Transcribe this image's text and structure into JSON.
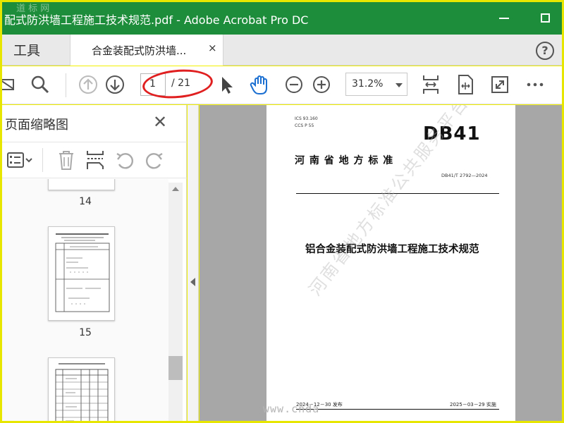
{
  "window": {
    "title": "配式防洪墙工程施工技术规范.pdf - Adobe Acrobat Pro DC",
    "corner_watermark": "道 标 网",
    "accent_color": "#1e8d3b"
  },
  "tabs": {
    "tools_label": "工具",
    "doc_tab_label": "合金装配式防洪墙...",
    "close_glyph": "×",
    "help_glyph": "?"
  },
  "toolbar": {
    "current_page": "1",
    "page_total": "/ 21",
    "zoom": "31.2%"
  },
  "sidebar": {
    "title": "页面缩略图",
    "close_glyph": "✕",
    "thumbnails": [
      {
        "label": "14"
      },
      {
        "label": "15"
      }
    ]
  },
  "document": {
    "ics": "ICS 93.160",
    "ccs": "CCS P 55",
    "logo": "DB41",
    "province_title": "河 南 省 地 方 标 准",
    "standard_number": "DB41/T 2792—2024",
    "doc_title": "铝合金装配式防洪墙工程施工技术规范",
    "publish_date": "2024－12－30 发布",
    "implement_date": "2025－03－29 实施",
    "watermark": "河南省地方标准公共服务平台",
    "site_watermark": "www.cnda"
  },
  "annotations": {
    "highlight_color": "#e02020"
  }
}
